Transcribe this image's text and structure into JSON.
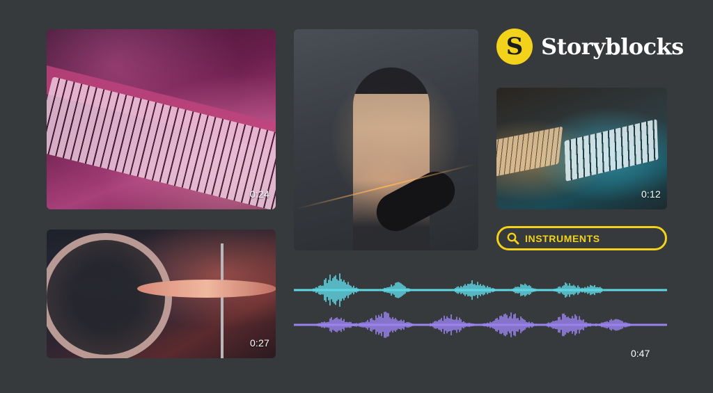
{
  "brand": {
    "logo_glyph": "S",
    "name": "Storyblocks"
  },
  "clips": [
    {
      "id": "keyboard",
      "duration": "0:24"
    },
    {
      "id": "drums",
      "duration": "0:27"
    },
    {
      "id": "guitarist"
    },
    {
      "id": "synth",
      "duration": "0:12"
    }
  ],
  "search": {
    "icon": "search-icon",
    "query": "INSTRUMENTS"
  },
  "audio": {
    "duration": "0:47"
  },
  "colors": {
    "background": "#363a3d",
    "accent_yellow": "#f3d21b",
    "wave_cyan": "#5fd6e3",
    "wave_purple": "#9b82ee"
  }
}
